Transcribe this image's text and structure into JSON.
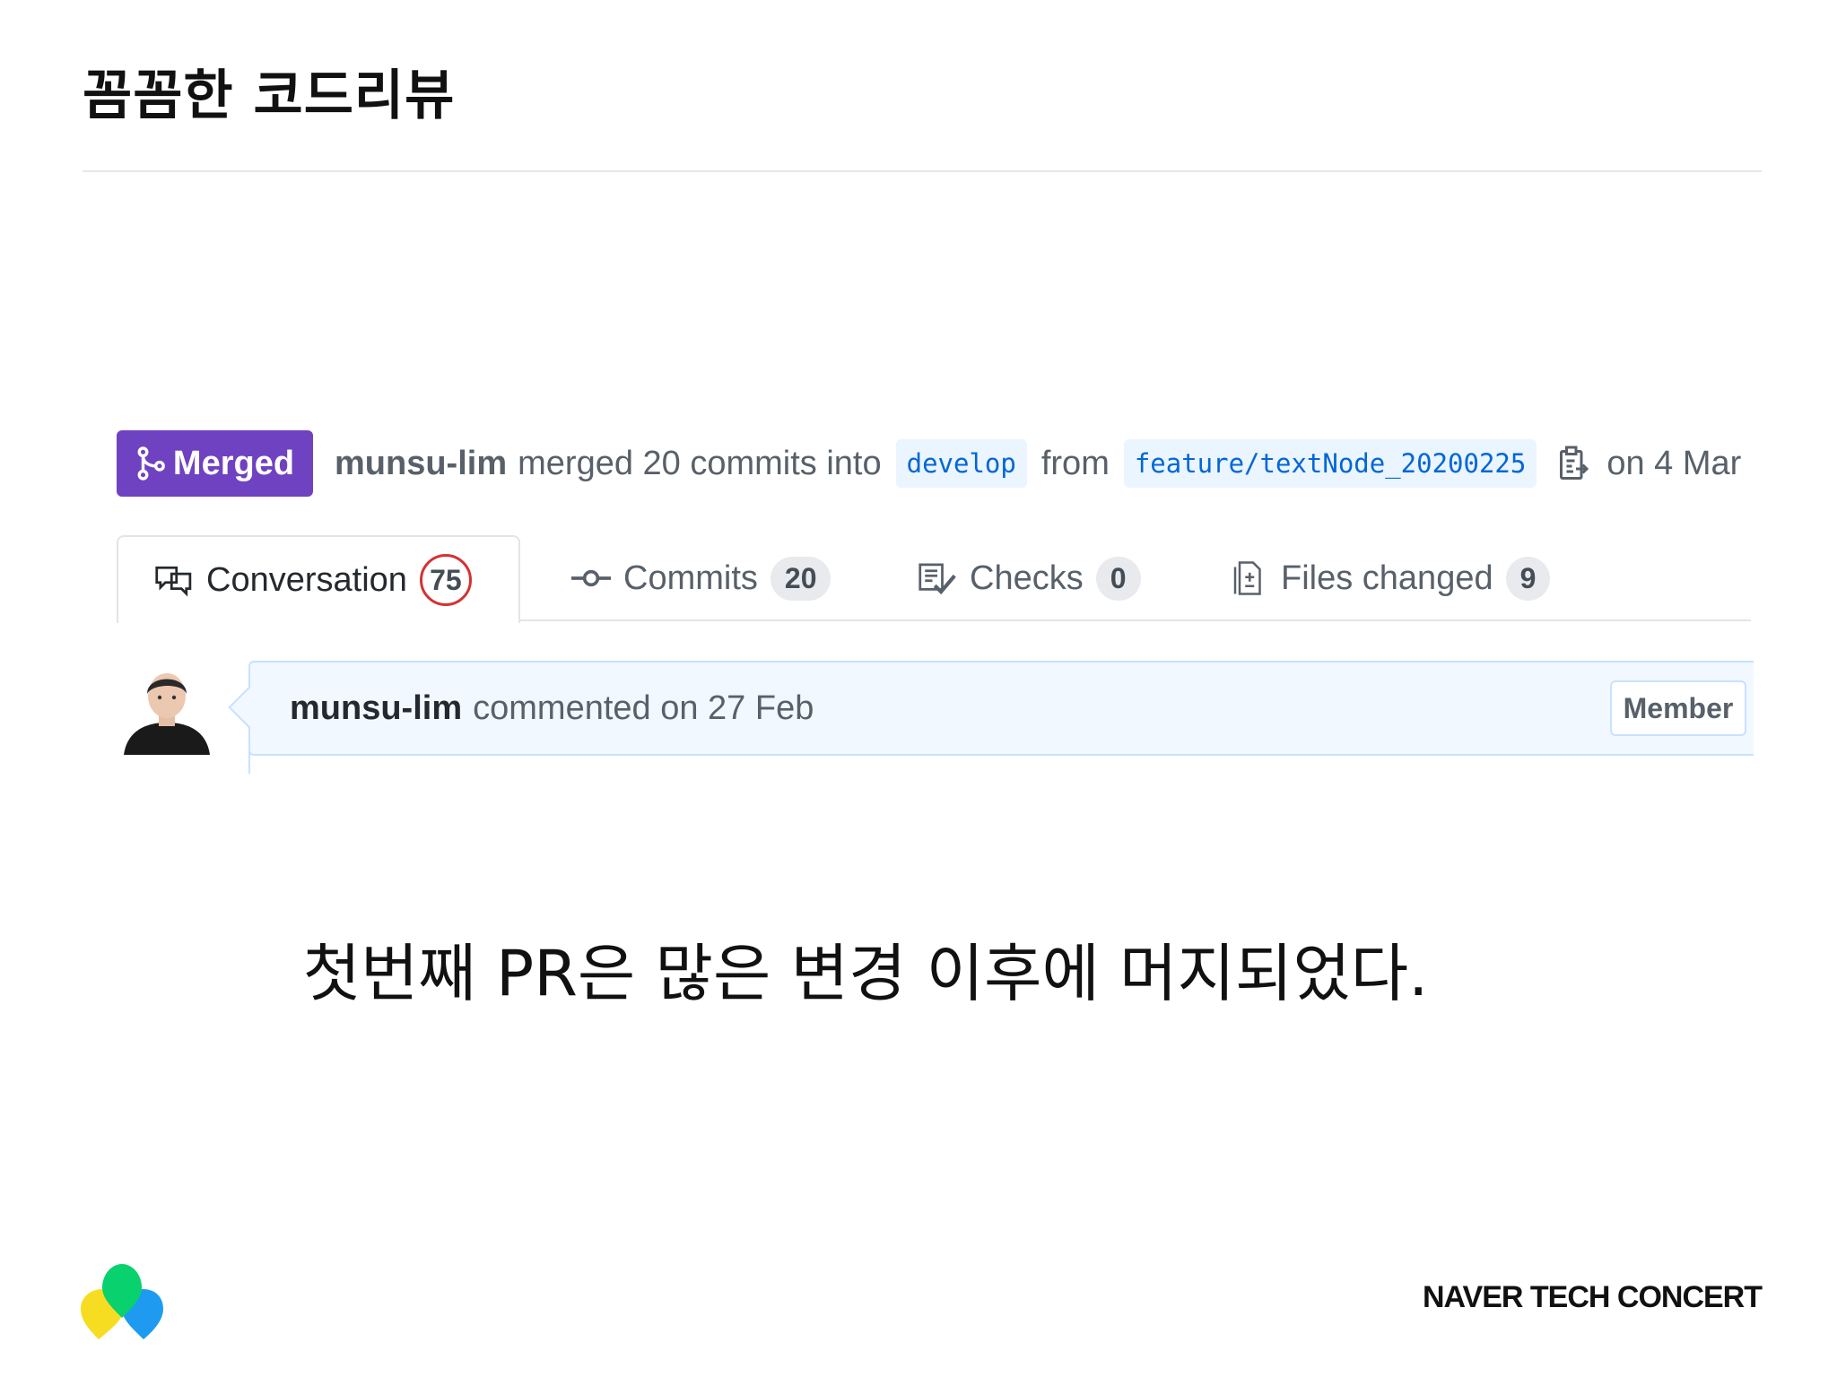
{
  "slide": {
    "title": "꼼꼼한 코드리뷰",
    "caption": "첫번째 PR은 많은 변경 이후에 머지되었다.",
    "footer_brand": "NAVER TECH CONCERT"
  },
  "pr": {
    "status_label": "Merged",
    "author": "munsu-lim",
    "merged_text": "merged 20 commits into",
    "base_branch": "develop",
    "from_text": "from",
    "head_branch": "feature/textNode_20200225",
    "date_text": "on 4 Mar"
  },
  "tabs": [
    {
      "label": "Conversation",
      "count": "75",
      "icon": "comment-discussion-icon"
    },
    {
      "label": "Commits",
      "count": "20",
      "icon": "git-commit-icon"
    },
    {
      "label": "Checks",
      "count": "0",
      "icon": "checklist-icon"
    },
    {
      "label": "Files changed",
      "count": "9",
      "icon": "file-diff-icon"
    }
  ],
  "comment": {
    "author": "munsu-lim",
    "meta": "commented on 27 Feb",
    "role_badge": "Member"
  },
  "colors": {
    "merged": "#6f42c1",
    "branch_text": "#0366d6",
    "branch_bg": "#eaf5ff",
    "highlight_circle": "#d33333"
  }
}
